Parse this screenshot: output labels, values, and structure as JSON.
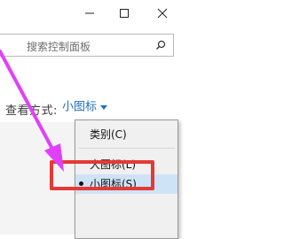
{
  "window": {
    "minimize_icon": "minimize-icon",
    "maximize_icon": "maximize-icon",
    "close_icon": "close-icon"
  },
  "search": {
    "placeholder": "搜索控制面板",
    "icon": "search-icon"
  },
  "view": {
    "label": "查看方式:",
    "current": "小图标",
    "caret_icon": "caret-down-icon"
  },
  "menu": {
    "items": [
      {
        "label": "类别(C)",
        "selected": false
      },
      {
        "label": "大图标(L)",
        "selected": false
      },
      {
        "label": "小图标(S)",
        "selected": true
      }
    ]
  },
  "colors": {
    "accent_link": "#1e6fbf",
    "annotation_red": "#e53935",
    "annotation_arrow": "#e040fb",
    "selected_bg": "#cfe3f7"
  }
}
